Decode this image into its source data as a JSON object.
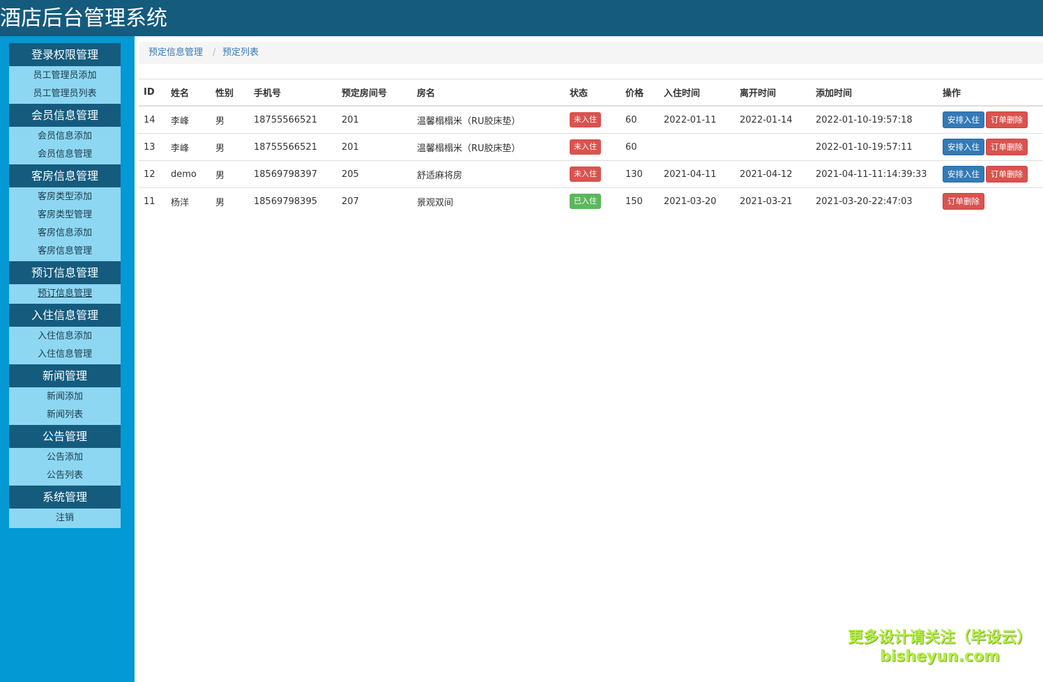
{
  "header": {
    "title": "酒店后台管理系统"
  },
  "sidebar": {
    "groups": [
      {
        "title": "登录权限管理",
        "items": [
          "员工管理员添加",
          "员工管理员列表"
        ]
      },
      {
        "title": "会员信息管理",
        "items": [
          "会员信息添加",
          "会员信息管理"
        ]
      },
      {
        "title": "客房信息管理",
        "items": [
          "客房类型添加",
          "客房类型管理",
          "客房信息添加",
          "客房信息管理"
        ]
      },
      {
        "title": "预订信息管理",
        "items": [
          "预订信息管理"
        ]
      },
      {
        "title": "入住信息管理",
        "items": [
          "入住信息添加",
          "入住信息管理"
        ]
      },
      {
        "title": "新闻管理",
        "items": [
          "新闻添加",
          "新闻列表"
        ]
      },
      {
        "title": "公告管理",
        "items": [
          "公告添加",
          "公告列表"
        ]
      },
      {
        "title": "系统管理",
        "items": [
          "注销"
        ]
      }
    ]
  },
  "breadcrumb": {
    "parent": "预定信息管理",
    "separator": "/",
    "current": "预定列表"
  },
  "table": {
    "headers": [
      "ID",
      "姓名",
      "性别",
      "手机号",
      "预定房间号",
      "房名",
      "状态",
      "价格",
      "入住时间",
      "离开时间",
      "添加时间",
      "操作"
    ],
    "rows": [
      {
        "id": "14",
        "name": "李峰",
        "gender": "男",
        "phone": "18755566521",
        "room_no": "201",
        "room_name": "温馨榻榻米（RU胶床垫）",
        "status": "未入住",
        "status_color": "#d9534f",
        "price": "60",
        "checkin": "2022-01-11",
        "checkout": "2022-01-14",
        "added": "2022-01-10-19:57:18",
        "actions": [
          "安排入住",
          "订单删除"
        ]
      },
      {
        "id": "13",
        "name": "李峰",
        "gender": "男",
        "phone": "18755566521",
        "room_no": "201",
        "room_name": "温馨榻榻米（RU胶床垫）",
        "status": "未入住",
        "status_color": "#d9534f",
        "price": "60",
        "checkin": "",
        "checkout": "",
        "added": "2022-01-10-19:57:11",
        "actions": [
          "安排入住",
          "订单删除"
        ]
      },
      {
        "id": "12",
        "name": "demo",
        "gender": "男",
        "phone": "18569798397",
        "room_no": "205",
        "room_name": "舒适麻将房",
        "status": "未入住",
        "status_color": "#d9534f",
        "price": "130",
        "checkin": "2021-04-11",
        "checkout": "2021-04-12",
        "added": "2021-04-11-11:14:39:33",
        "actions": [
          "安排入住",
          "订单删除"
        ]
      },
      {
        "id": "11",
        "name": "杨洋",
        "gender": "男",
        "phone": "18569798395",
        "room_no": "207",
        "room_name": "景观双间",
        "status": "已入住",
        "status_color": "#5cb85c",
        "price": "150",
        "checkin": "2021-03-20",
        "checkout": "2021-03-21",
        "added": "2021-03-20-22:47:03",
        "actions": [
          "订单删除"
        ]
      }
    ]
  },
  "watermark": {
    "line1": "更多设计请关注（毕设云）",
    "line2": "bisheyun.com"
  }
}
